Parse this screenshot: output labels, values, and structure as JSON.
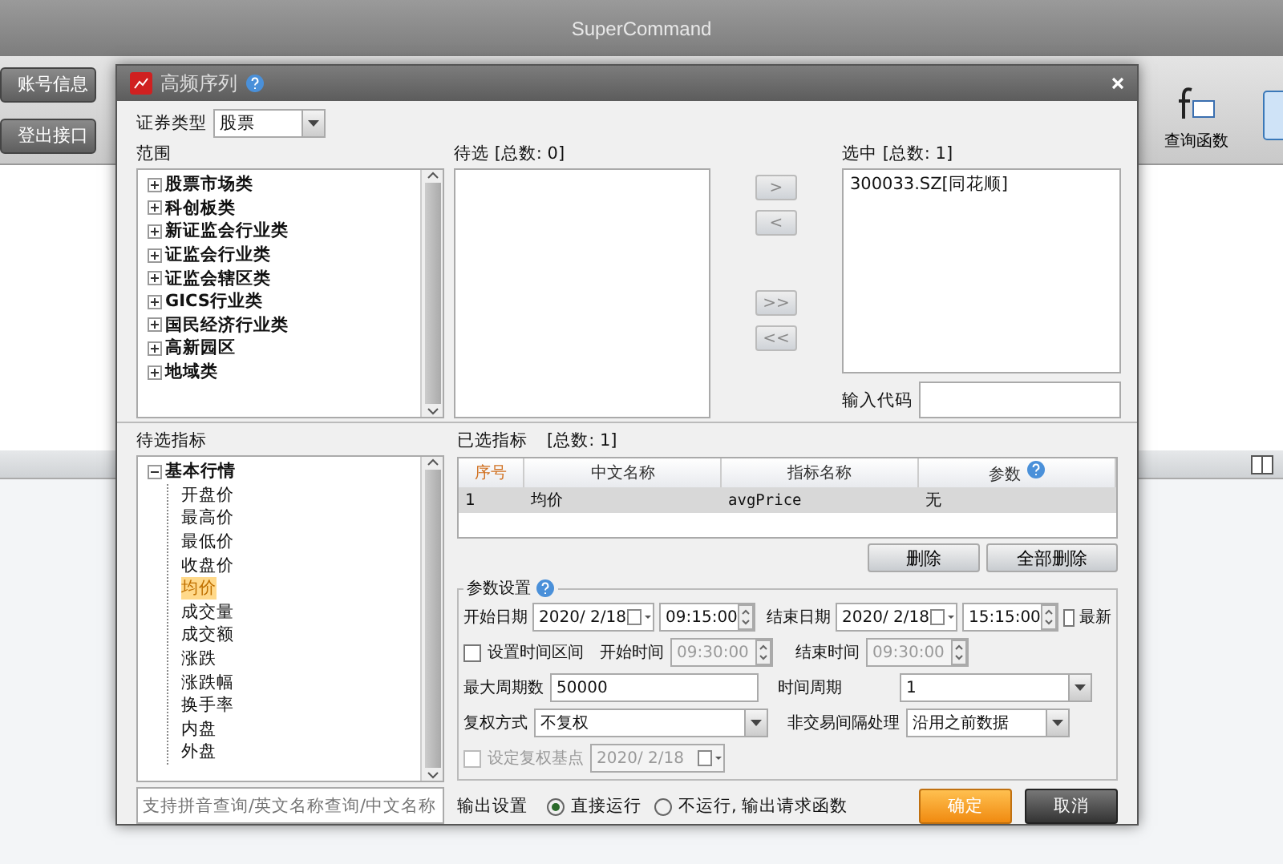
{
  "app": {
    "title": "SuperCommand",
    "left_buttons": [
      "账号信息",
      "登出接口"
    ],
    "right_tools": [
      {
        "label": "查询函数"
      }
    ]
  },
  "dialog": {
    "title": "高频序列",
    "security_type": {
      "label": "证券类型",
      "value": "股票"
    },
    "scope": {
      "label": "范围",
      "items": [
        {
          "label": "股票市场类",
          "expanded": false
        },
        {
          "label": "科创板类",
          "expanded": false
        },
        {
          "label": "新证监会行业类",
          "expanded": false
        },
        {
          "label": "证监会行业类",
          "expanded": false
        },
        {
          "label": "证监会辖区类",
          "expanded": false
        },
        {
          "label": "GICS行业类",
          "expanded": false
        },
        {
          "label": "国民经济行业类",
          "expanded": false
        },
        {
          "label": "高新园区",
          "expanded": false
        },
        {
          "label": "地域类",
          "expanded": false
        }
      ]
    },
    "pending": {
      "label": "待选 [总数: 0]"
    },
    "transfer_buttons": [
      ">",
      "<",
      ">>",
      "<<"
    ],
    "chosen": {
      "label": "选中 [总数: 1]",
      "items": [
        "300033.SZ[同花顺]"
      ]
    },
    "code_input": {
      "label": "输入代码"
    },
    "indicators": {
      "label": "待选指标",
      "items": [
        {
          "label": "基本行情",
          "expanded": true,
          "children": [
            {
              "label": "开盘价",
              "selected": false
            },
            {
              "label": "最高价",
              "selected": false
            },
            {
              "label": "最低价",
              "selected": false
            },
            {
              "label": "收盘价",
              "selected": false
            },
            {
              "label": "均价",
              "selected": true
            },
            {
              "label": "成交量",
              "selected": false
            },
            {
              "label": "成交额",
              "selected": false
            },
            {
              "label": "涨跌",
              "selected": false
            },
            {
              "label": "涨跌幅",
              "selected": false
            },
            {
              "label": "换手率",
              "selected": false
            },
            {
              "label": "内盘",
              "selected": false
            },
            {
              "label": "外盘",
              "selected": false
            }
          ]
        }
      ],
      "search": {
        "placeholder": "支持拼音查询/英文名称查询/中文名称"
      }
    },
    "table": {
      "label": "已选指标",
      "count": "[总数: 1]",
      "columns": [
        "序号",
        "中文名称",
        "指标名称",
        "参数"
      ],
      "rows": [
        {
          "cells": [
            "1",
            "均价",
            "avgPrice",
            "无"
          ],
          "selected": true
        }
      ],
      "buttons": [
        "删除",
        "全部删除"
      ]
    },
    "params": {
      "title": "参数设置",
      "start": {
        "label": "开始日期",
        "date": "2020/ 2/18",
        "time": "09:15:00"
      },
      "end": {
        "label": "结束日期",
        "date": "2020/ 2/18",
        "time": "15:15:00"
      },
      "latest": {
        "label": "最新",
        "checked": false
      },
      "range": {
        "label": "设置时间区间",
        "checked": false,
        "start_label": "开始时间",
        "start_time": "09:30:00",
        "end_label": "结束时间",
        "end_time": "09:30:00",
        "disabled": true
      },
      "max_periods": {
        "label": "最大周期数",
        "value": "50000"
      },
      "period": {
        "label": "时间周期",
        "value": "1"
      },
      "adjust": {
        "label": "复权方式",
        "value": "不复权"
      },
      "gap": {
        "label": "非交易间隔处理",
        "value": "沿用之前数据"
      },
      "base": {
        "label": "设定复权基点",
        "checked": false,
        "date": "2020/ 2/18",
        "disabled": true
      }
    },
    "output": {
      "label": "输出设置",
      "options": [
        {
          "label": "直接运行",
          "selected": true
        },
        {
          "label": "不运行, 输出请求函数",
          "selected": false
        }
      ]
    },
    "buttons": [
      {
        "label": "确定",
        "kind": "primary"
      },
      {
        "label": "取消",
        "kind": "secondary"
      }
    ]
  }
}
